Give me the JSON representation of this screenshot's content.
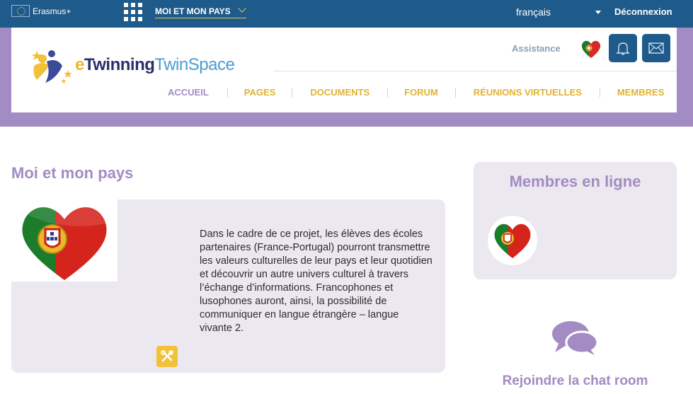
{
  "topbar": {
    "eu_label": "Erasmus+",
    "menu_selected": "MOI ET MON PAYS",
    "language": "français",
    "logout": "Déconnexion"
  },
  "header": {
    "logo_e": "e",
    "logo_twinning": "Twinning",
    "logo_twinspace": "TwinSpace",
    "assistance": "Assistance",
    "nav": [
      {
        "label": "ACCUEIL"
      },
      {
        "label": "PAGES"
      },
      {
        "label": "DOCUMENTS"
      },
      {
        "label": "FORUM"
      },
      {
        "label": "RÉUNIONS VIRTUELLES"
      },
      {
        "label": "MEMBRES"
      }
    ]
  },
  "main": {
    "title": "Moi et mon pays",
    "description": "Dans le cadre de ce projet, les élèves des écoles partenaires (France-Portugal) pourront transmettre les valeurs culturelles de leur pays et leur quotidien et découvrir un autre univers culturel à travers l’échange d’informations. Francophones et lusophones auront, ainsi, la possibilité de communiquer en langue étrangère – langue vivante 2."
  },
  "sidebar": {
    "online_title": "Membres en ligne",
    "chat_link": "Rejoindre la chat room"
  },
  "colors": {
    "topbar": "#1e5a8a",
    "accent_purple": "#a38bc3",
    "nav_yellow": "#e0b233",
    "card_bg": "#ebe8ef"
  },
  "icons": [
    "eu-flag-icon",
    "apps-grid-icon",
    "chevron-down-icon",
    "caret-down-icon",
    "portugal-heart-icon",
    "bell-icon",
    "mail-icon",
    "tools-icon",
    "chat-bubbles-icon"
  ]
}
